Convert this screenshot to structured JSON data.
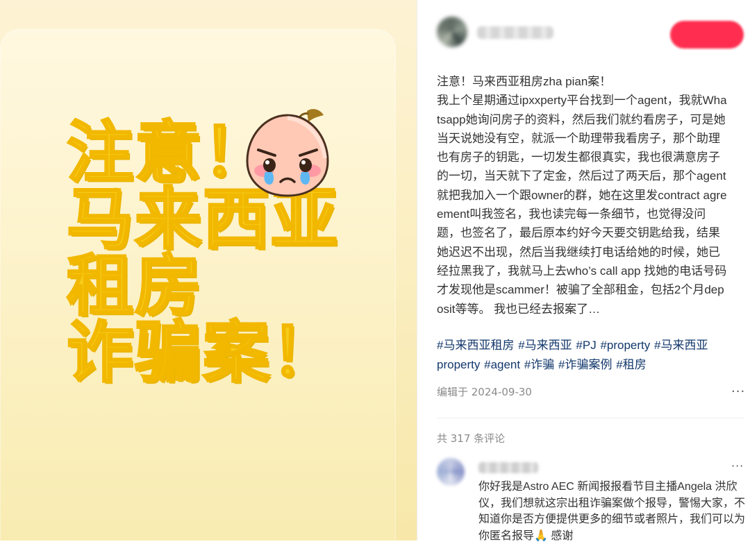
{
  "image": {
    "headline_lines": [
      "注意！",
      "马来西亚",
      "租房",
      "诈骗案！"
    ],
    "emoji_icon": "crying-peach-emoji-icon"
  },
  "post": {
    "author_name": "",
    "follow_label": "",
    "body_lines": [
      "注意！马来西亚租房zha pian案！",
      "我上个星期通过ipxxperty平台找到一个agent，我就Whatsapp她询问房子的资料，然后我们就约看房子，可是她当天说她没有空，就派一个助理带我看房子，那个助理也有房子的钥匙，一切发生都很真实，我也很满意房子的一切，当天就下了定金，然后过了两天后，那个agent就把我加入一个跟owner的群，她在这里发contract agreement叫我签名，我也读完每一条细节，也觉得没问题，也签名了，最后原本约好今天要交钥匙给我，结果她迟迟不出现，然后当我继续打电话给她的时候，她已经拉黑我了，我就马上去who’s call app 找她的电话号码 才发现他是scammer！被骗了全部租金，包括2个月deposit等等。 我也已经去报案了…"
    ],
    "tags": [
      "#马来西亚租房",
      "#马来西亚",
      "#PJ",
      "#property",
      "#马来西亚property",
      "#agent",
      "#诈骗",
      "#诈骗案例",
      "#租房"
    ],
    "edit_date": "编辑于 2024-09-30",
    "more_label": "···"
  },
  "comments": {
    "count_label": "共 317 条评论",
    "items": [
      {
        "user_name": "",
        "text": "你好我是Astro AEC 新闻报报看节目主播Angela 洪欣仪，我们想就这宗出租诈骗案做个报导，警惕大家，不知道你是否方便提供更多的细节或者照片，我们可以为你匿名报导🙏 感谢",
        "more_label": "···"
      }
    ]
  },
  "colors": {
    "headline": "#f7cc1a",
    "tag": "#13386c",
    "follow": "#ff2e50",
    "bg_left": "#fbeec0"
  }
}
